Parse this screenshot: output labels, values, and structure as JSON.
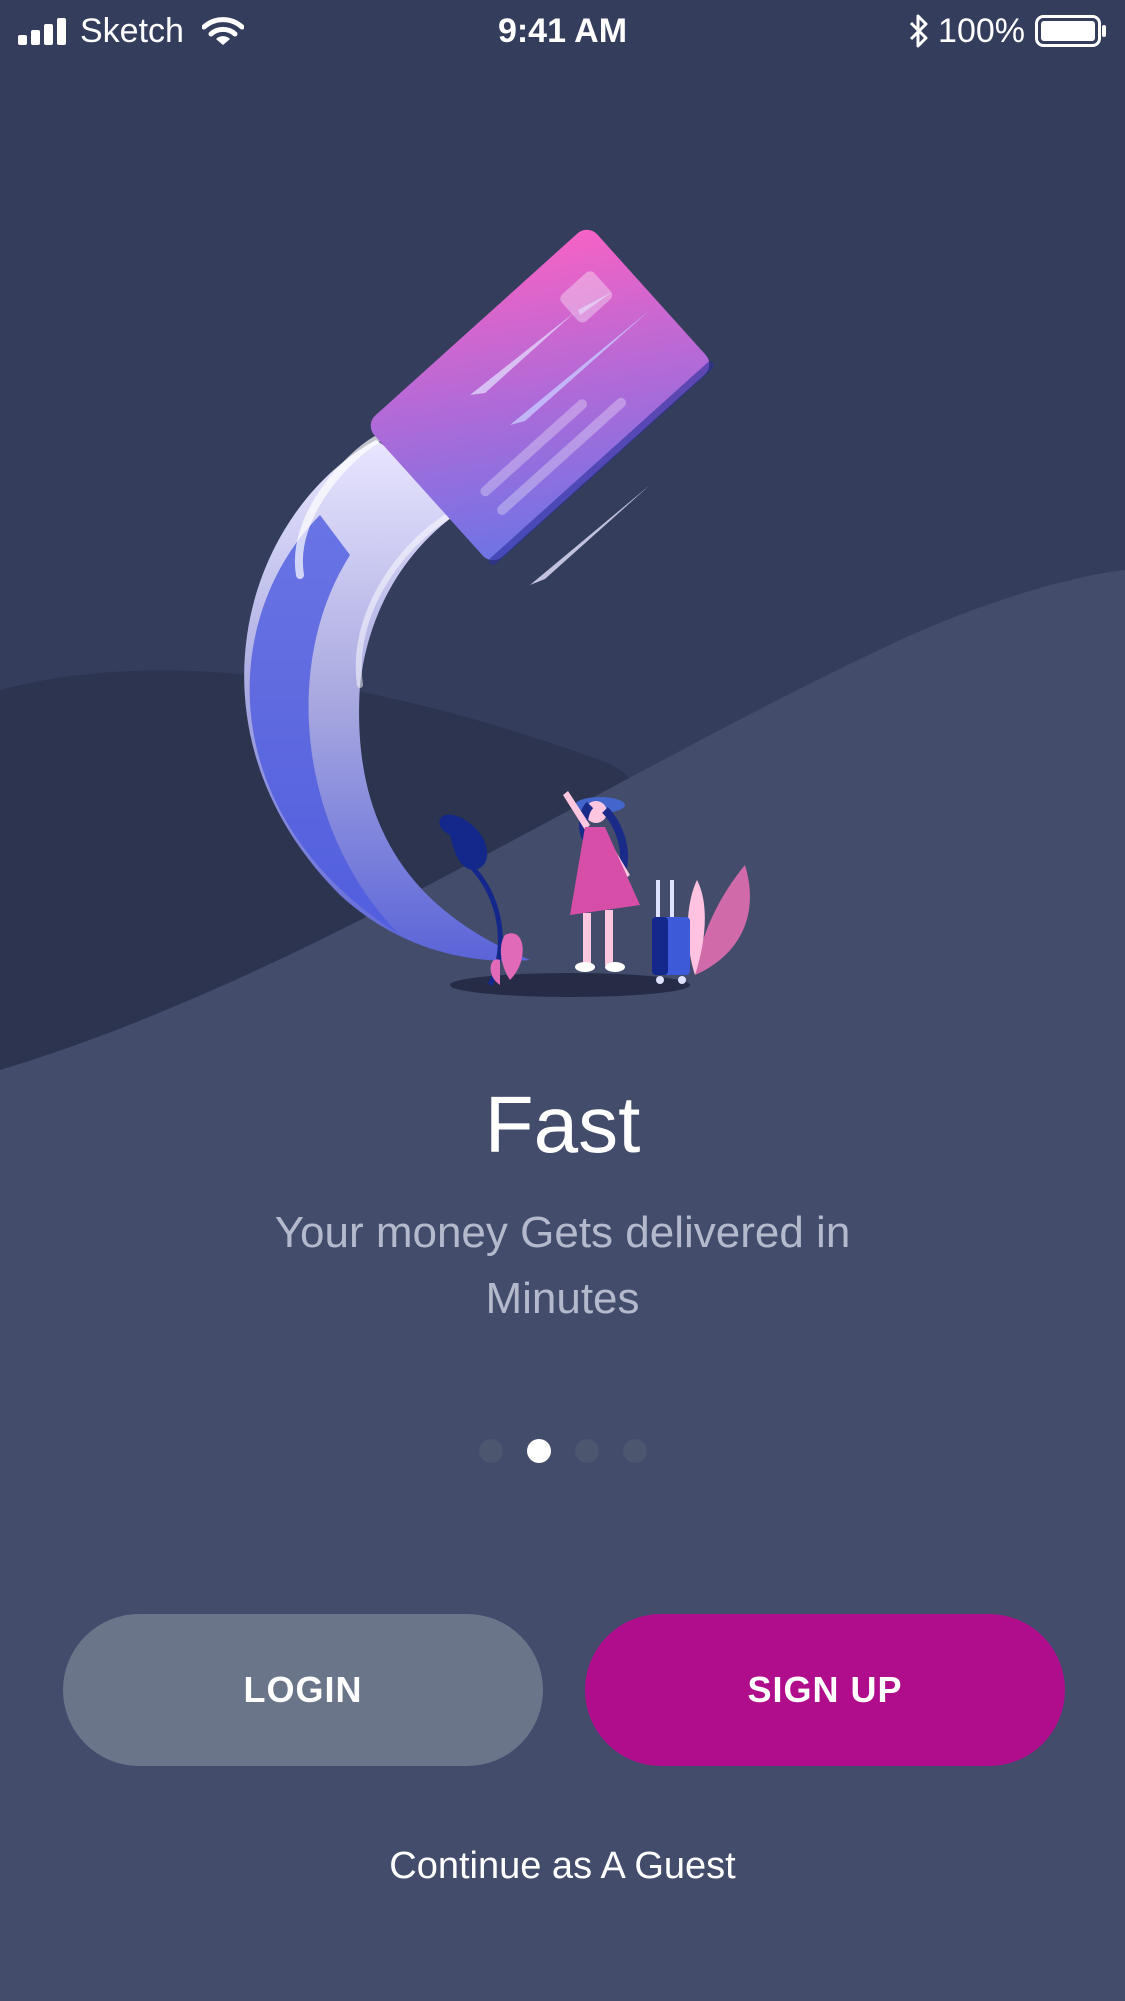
{
  "status_bar": {
    "carrier": "Sketch",
    "time": "9:41 AM",
    "battery": "100%",
    "icons": [
      "signal-icon",
      "wifi-icon",
      "bluetooth-icon",
      "battery-icon"
    ]
  },
  "onboarding": {
    "title": "Fast",
    "subtitle": "Your money Gets delivered in Minutes",
    "pagination": {
      "total": 4,
      "active": 2
    }
  },
  "actions": {
    "login_label": "LOGIN",
    "signup_label": "SIGN UP",
    "guest_label": "Continue as A Guest"
  },
  "colors": {
    "background": "#343d5c",
    "hill": "#444d6c",
    "login_button": "#6b7589",
    "signup_button": "#b00d8c",
    "card_pink": "#f062c0",
    "card_purple": "#8c6be0"
  }
}
